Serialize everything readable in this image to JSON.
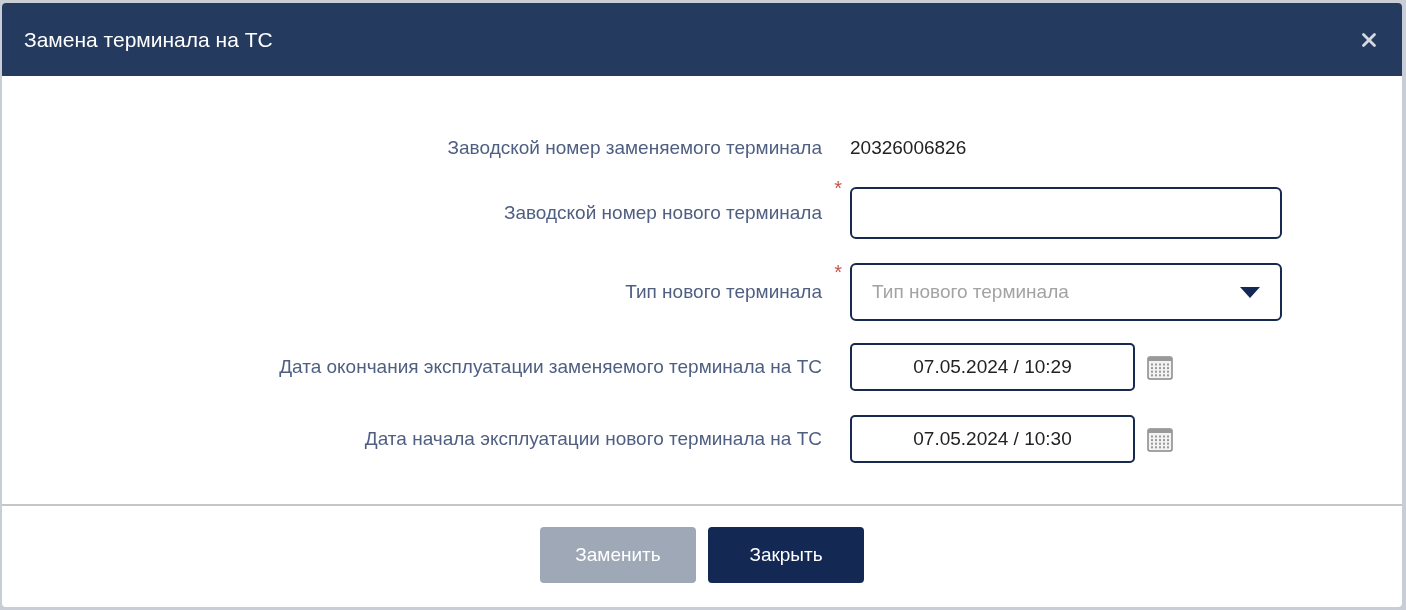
{
  "dialog": {
    "title": "Замена терминала на ТС"
  },
  "fields": [
    {
      "kind": "static",
      "label": "Заводской номер заменяемого терминала",
      "value": "20326006826"
    },
    {
      "kind": "text",
      "label": "Заводской номер нового терминала",
      "required_mark": "*"
    },
    {
      "kind": "select",
      "label": "Тип нового терминала",
      "required_mark": "*",
      "placeholder": "Тип нового терминала"
    },
    {
      "kind": "date",
      "label": "Дата окончания эксплуатации заменяемого терминала на ТС",
      "value": "07.05.2024 / 10:29"
    },
    {
      "kind": "date",
      "label": "Дата начала эксплуатации нового терминала на ТС",
      "value": "07.05.2024 / 10:30"
    }
  ],
  "buttons": [
    {
      "label": "Заменить",
      "disabled": true
    },
    {
      "label": "Закрыть",
      "disabled": false
    }
  ]
}
